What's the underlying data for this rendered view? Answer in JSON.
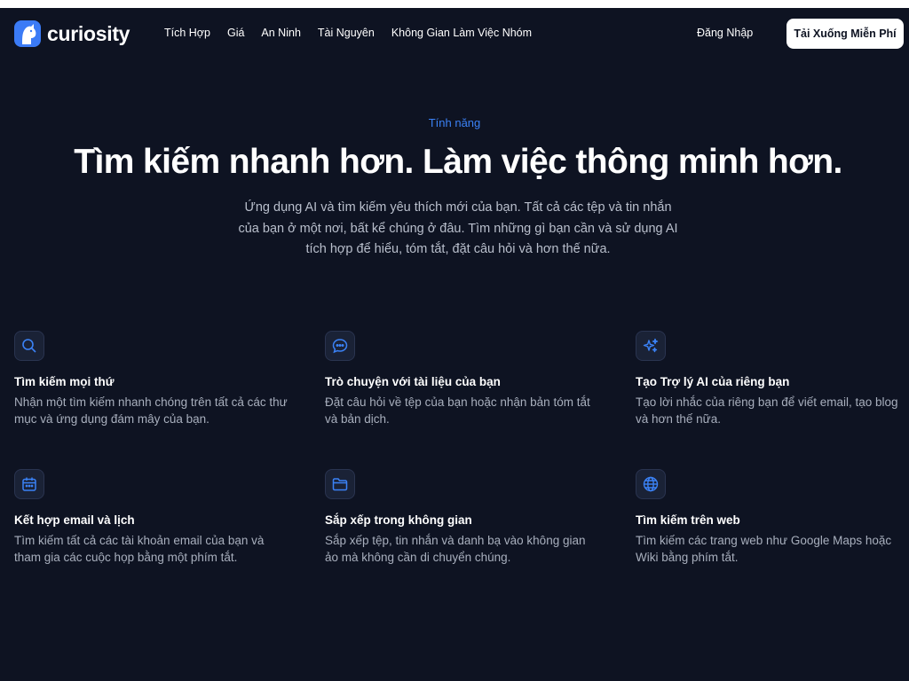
{
  "brand": {
    "name": "curiosity",
    "logo_icon": "curiosity-logo-icon",
    "accent": "#3b7bf6"
  },
  "nav": {
    "links": [
      "Tích Hợp",
      "Giá",
      "An Ninh",
      "Tài Nguyên",
      "Không Gian Làm Việc Nhóm"
    ],
    "login": "Đăng Nhập",
    "download": "Tải Xuống Miễn Phí"
  },
  "hero": {
    "eyebrow": "Tính năng",
    "title": "Tìm kiếm nhanh hơn. Làm việc thông minh hơn.",
    "subtitle": "Ứng dụng AI và tìm kiếm yêu thích mới của bạn. Tất cả các tệp và tin nhắn của bạn ở một nơi, bất kể chúng ở đâu. Tìm những gì bạn cần và sử dụng AI tích hợp để hiểu, tóm tắt, đặt câu hỏi và hơn thế nữa."
  },
  "features": [
    {
      "icon": "search-icon",
      "title": "Tìm kiếm mọi thứ",
      "desc": "Nhận một tìm kiếm nhanh chóng trên tất cả các thư mục và ứng dụng đám mây của bạn."
    },
    {
      "icon": "chat-icon",
      "title": "Trò chuyện với tài liệu của bạn",
      "desc": "Đặt câu hỏi về tệp của bạn hoặc nhận bản tóm tắt và bản dịch."
    },
    {
      "icon": "sparkles-icon",
      "title": "Tạo Trợ lý AI của riêng bạn",
      "desc": "Tạo lời nhắc của riêng bạn để viết email, tạo blog và hơn thế nữa."
    },
    {
      "icon": "calendar-icon",
      "title": "Kết hợp email và lịch",
      "desc": "Tìm kiếm tất cả các tài khoản email của bạn và tham gia các cuộc họp bằng một phím tắt."
    },
    {
      "icon": "folder-icon",
      "title": "Sắp xếp trong không gian",
      "desc": "Sắp xếp tệp, tin nhắn và danh bạ vào không gian ảo mà không cần di chuyển chúng."
    },
    {
      "icon": "globe-icon",
      "title": "Tìm kiếm trên web",
      "desc": "Tìm kiếm các trang web như Google Maps hoặc Wiki bằng phím tắt."
    }
  ]
}
